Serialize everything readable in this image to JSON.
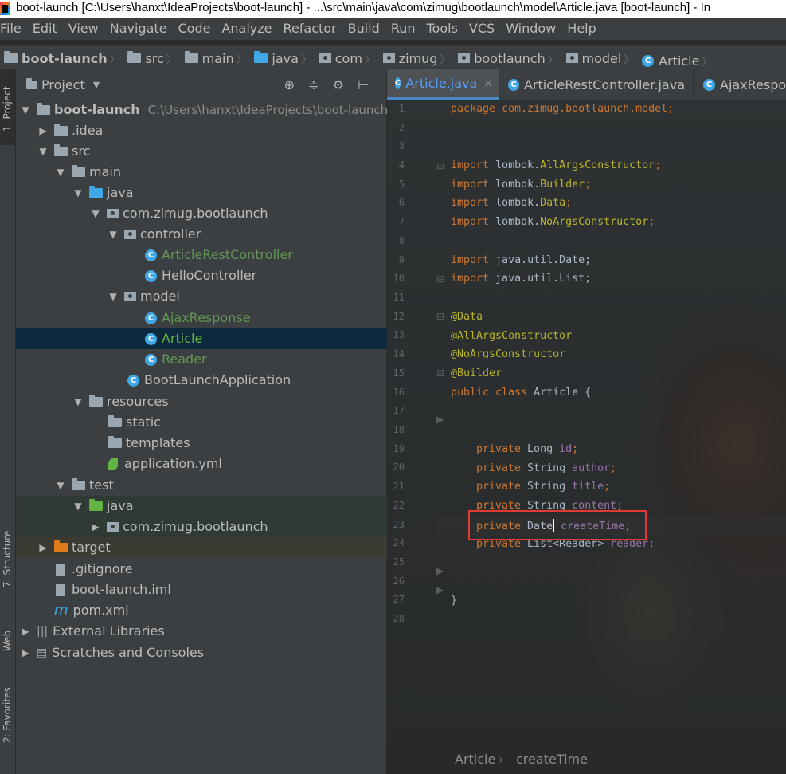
{
  "window": {
    "title": "boot-launch [C:\\Users\\hanxt\\IdeaProjects\\boot-launch] - ...\\src\\main\\java\\com\\zimug\\bootlaunch\\model\\Article.java [boot-launch] - In"
  },
  "menu": [
    "File",
    "Edit",
    "View",
    "Navigate",
    "Code",
    "Analyze",
    "Refactor",
    "Build",
    "Run",
    "Tools",
    "VCS",
    "Window",
    "Help"
  ],
  "breadcrumbs": [
    "boot-launch",
    "src",
    "main",
    "java",
    "com",
    "zimug",
    "bootlaunch",
    "model",
    "Article"
  ],
  "left_strip": {
    "project": "1: Project",
    "structure": "7: Structure",
    "web": "Web",
    "favorites": "2: Favorites"
  },
  "project_panel": {
    "title": "Project",
    "tools": "⊕ ≑ ⚙ ⊢",
    "tree": [
      {
        "label": "boot-launch",
        "path": "C:\\Users\\hanxt\\IdeaProjects\\boot-launch"
      },
      {
        "label": ".idea"
      },
      {
        "label": "src"
      },
      {
        "label": "main"
      },
      {
        "label": "java"
      },
      {
        "label": "com.zimug.bootlaunch"
      },
      {
        "label": "controller"
      },
      {
        "label": "ArticleRestController"
      },
      {
        "label": "HelloController"
      },
      {
        "label": "model"
      },
      {
        "label": "AjaxResponse"
      },
      {
        "label": "Article"
      },
      {
        "label": "Reader"
      },
      {
        "label": "BootLaunchApplication"
      },
      {
        "label": "resources"
      },
      {
        "label": "static"
      },
      {
        "label": "templates"
      },
      {
        "label": "application.yml"
      },
      {
        "label": "test"
      },
      {
        "label": "java"
      },
      {
        "label": "com.zimug.bootlaunch"
      },
      {
        "label": "target"
      },
      {
        "label": ".gitignore"
      },
      {
        "label": "boot-launch.iml"
      },
      {
        "label": "pom.xml"
      },
      {
        "label": "External Libraries"
      },
      {
        "label": "Scratches and Consoles"
      }
    ]
  },
  "editor": {
    "tabs": [
      "Article.java",
      "ArticleRestController.java",
      "AjaxRespo"
    ],
    "line_numbers": [
      "1",
      "2",
      "3",
      "4",
      "5",
      "6",
      "7",
      "8",
      "9",
      "10",
      "11",
      "12",
      "13",
      "14",
      "15",
      "16",
      "17",
      "18",
      "19",
      "20",
      "21",
      "22",
      "23",
      "24",
      "25",
      "26",
      "27",
      "28"
    ],
    "code": {
      "l1": "package com.zimug.bootlaunch.model;",
      "l4a": "import",
      "l4b": " lombok.",
      "l4c": "AllArgsConstructor",
      "l4d": ";",
      "l5a": "import",
      "l5b": " lombok.",
      "l5c": "Builder",
      "l5d": ";",
      "l6a": "import",
      "l6b": " lombok.",
      "l6c": "Data",
      "l6d": ";",
      "l7a": "import",
      "l7b": " lombok.",
      "l7c": "NoArgsConstructor",
      "l7d": ";",
      "l9a": "import",
      "l9b": " java.util.Date;",
      "l10a": "import",
      "l10b": " java.util.List;",
      "l12": "@Data",
      "l13": "@AllArgsConstructor",
      "l14": "@NoArgsConstructor",
      "l15": "@Builder",
      "l16a": "public class",
      "l16b": " Article {",
      "l19a": "private",
      "l19b": " Long ",
      "l19c": "id",
      "l19d": ";",
      "l20a": "private",
      "l20b": " String ",
      "l20c": "author",
      "l20d": ";",
      "l21a": "private",
      "l21b": " String ",
      "l21c": "title",
      "l21d": ";",
      "l22a": "private",
      "l22b": " String ",
      "l22c": "content",
      "l22d": ";",
      "l23a": "private",
      "l23b": " Date",
      "l23c": " createTime",
      "l23d": ";",
      "l24a": "private",
      "l24b": " List<Reader> ",
      "l24c": "reader",
      "l24d": ";",
      "l27": "}"
    },
    "status_breadcrumb": [
      "Article",
      "createTime"
    ]
  }
}
